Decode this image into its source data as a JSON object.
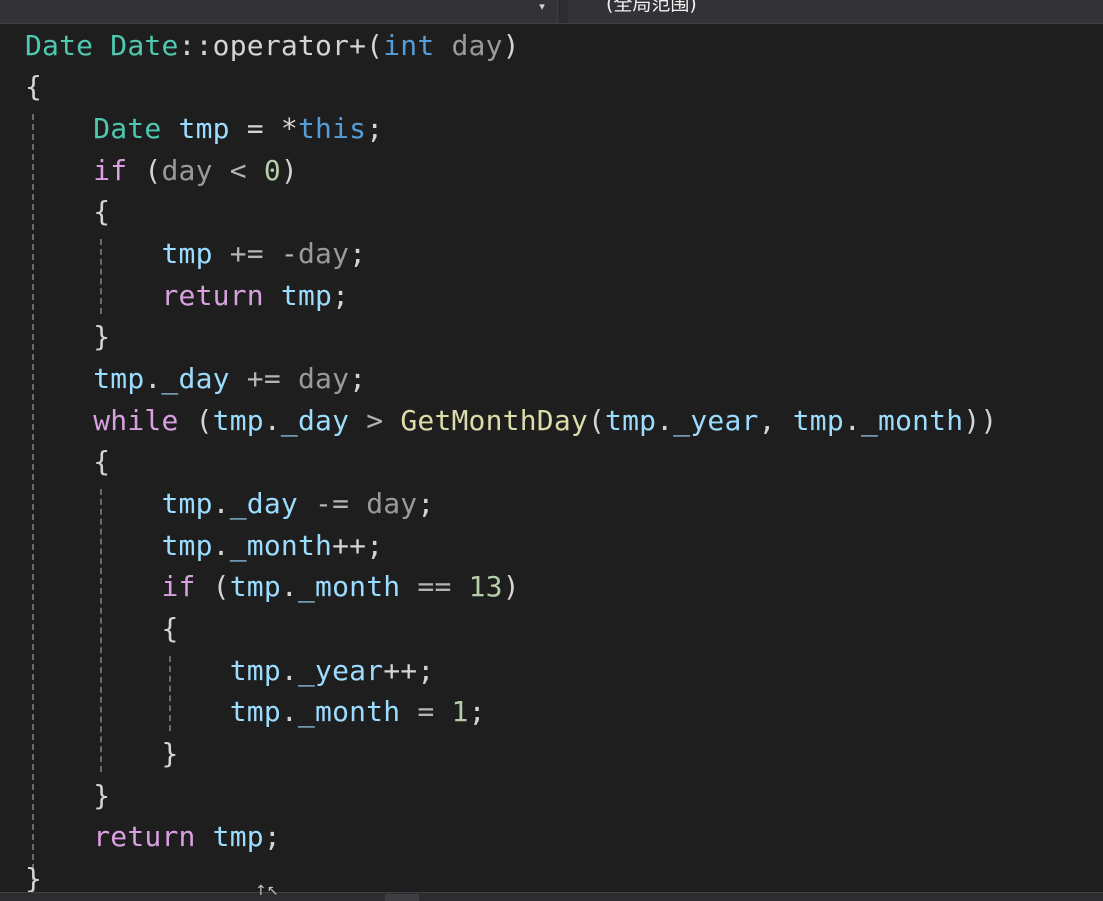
{
  "navigation_bar": {
    "member_dropdown_arrow": "▾",
    "scope_label": "(全局范围)"
  },
  "code": {
    "lines": [
      [
        {
          "t": "Date",
          "c": "type"
        },
        {
          "t": " ",
          "c": "punc"
        },
        {
          "t": "Date",
          "c": "type"
        },
        {
          "t": "::operator+(",
          "c": "punc"
        },
        {
          "t": "int",
          "c": "kw"
        },
        {
          "t": " ",
          "c": "punc"
        },
        {
          "t": "day",
          "c": "param"
        },
        {
          "t": ")",
          "c": "punc"
        }
      ],
      [
        {
          "t": "{",
          "c": "punc"
        }
      ],
      [
        {
          "t": "    ",
          "c": "punc"
        },
        {
          "t": "Date",
          "c": "type"
        },
        {
          "t": " ",
          "c": "punc"
        },
        {
          "t": "tmp",
          "c": "var"
        },
        {
          "t": " = *",
          "c": "punc"
        },
        {
          "t": "this",
          "c": "kw"
        },
        {
          "t": ";",
          "c": "punc"
        }
      ],
      [
        {
          "t": "    ",
          "c": "punc"
        },
        {
          "t": "if",
          "c": "ctrl"
        },
        {
          "t": " (",
          "c": "punc"
        },
        {
          "t": "day",
          "c": "param"
        },
        {
          "t": " < ",
          "c": "op"
        },
        {
          "t": "0",
          "c": "num"
        },
        {
          "t": ")",
          "c": "punc"
        }
      ],
      [
        {
          "t": "    ",
          "c": "punc"
        },
        {
          "t": "{",
          "c": "punc"
        }
      ],
      [
        {
          "t": "        ",
          "c": "punc"
        },
        {
          "t": "tmp",
          "c": "var"
        },
        {
          "t": " += -",
          "c": "op"
        },
        {
          "t": "day",
          "c": "param"
        },
        {
          "t": ";",
          "c": "punc"
        }
      ],
      [
        {
          "t": "        ",
          "c": "punc"
        },
        {
          "t": "return",
          "c": "ctrl"
        },
        {
          "t": " ",
          "c": "punc"
        },
        {
          "t": "tmp",
          "c": "var"
        },
        {
          "t": ";",
          "c": "punc"
        }
      ],
      [
        {
          "t": "    ",
          "c": "punc"
        },
        {
          "t": "}",
          "c": "punc"
        }
      ],
      [
        {
          "t": "    ",
          "c": "punc"
        },
        {
          "t": "tmp",
          "c": "var"
        },
        {
          "t": ".",
          "c": "punc"
        },
        {
          "t": "_day",
          "c": "var"
        },
        {
          "t": " += ",
          "c": "op"
        },
        {
          "t": "day",
          "c": "param"
        },
        {
          "t": ";",
          "c": "punc"
        }
      ],
      [
        {
          "t": "    ",
          "c": "punc"
        },
        {
          "t": "while",
          "c": "ctrl"
        },
        {
          "t": " (",
          "c": "punc"
        },
        {
          "t": "tmp",
          "c": "var"
        },
        {
          "t": ".",
          "c": "punc"
        },
        {
          "t": "_day",
          "c": "var"
        },
        {
          "t": " > ",
          "c": "op"
        },
        {
          "t": "GetMonthDay",
          "c": "fn"
        },
        {
          "t": "(",
          "c": "punc"
        },
        {
          "t": "tmp",
          "c": "var"
        },
        {
          "t": ".",
          "c": "punc"
        },
        {
          "t": "_year",
          "c": "var"
        },
        {
          "t": ", ",
          "c": "punc"
        },
        {
          "t": "tmp",
          "c": "var"
        },
        {
          "t": ".",
          "c": "punc"
        },
        {
          "t": "_month",
          "c": "var"
        },
        {
          "t": "))",
          "c": "punc"
        }
      ],
      [
        {
          "t": "    ",
          "c": "punc"
        },
        {
          "t": "{",
          "c": "punc"
        }
      ],
      [
        {
          "t": "        ",
          "c": "punc"
        },
        {
          "t": "tmp",
          "c": "var"
        },
        {
          "t": ".",
          "c": "punc"
        },
        {
          "t": "_day",
          "c": "var"
        },
        {
          "t": " -= ",
          "c": "op"
        },
        {
          "t": "day",
          "c": "param"
        },
        {
          "t": ";",
          "c": "punc"
        }
      ],
      [
        {
          "t": "        ",
          "c": "punc"
        },
        {
          "t": "tmp",
          "c": "var"
        },
        {
          "t": ".",
          "c": "punc"
        },
        {
          "t": "_month",
          "c": "var"
        },
        {
          "t": "++;",
          "c": "punc"
        }
      ],
      [
        {
          "t": "        ",
          "c": "punc"
        },
        {
          "t": "if",
          "c": "ctrl"
        },
        {
          "t": " (",
          "c": "punc"
        },
        {
          "t": "tmp",
          "c": "var"
        },
        {
          "t": ".",
          "c": "punc"
        },
        {
          "t": "_month",
          "c": "var"
        },
        {
          "t": " == ",
          "c": "op"
        },
        {
          "t": "13",
          "c": "num"
        },
        {
          "t": ")",
          "c": "punc"
        }
      ],
      [
        {
          "t": "        ",
          "c": "punc"
        },
        {
          "t": "{",
          "c": "punc"
        }
      ],
      [
        {
          "t": "            ",
          "c": "punc"
        },
        {
          "t": "tmp",
          "c": "var"
        },
        {
          "t": ".",
          "c": "punc"
        },
        {
          "t": "_year",
          "c": "var"
        },
        {
          "t": "++;",
          "c": "punc"
        }
      ],
      [
        {
          "t": "            ",
          "c": "punc"
        },
        {
          "t": "tmp",
          "c": "var"
        },
        {
          "t": ".",
          "c": "punc"
        },
        {
          "t": "_month",
          "c": "var"
        },
        {
          "t": " = ",
          "c": "op"
        },
        {
          "t": "1",
          "c": "num"
        },
        {
          "t": ";",
          "c": "punc"
        }
      ],
      [
        {
          "t": "        ",
          "c": "punc"
        },
        {
          "t": "}",
          "c": "punc"
        }
      ],
      [
        {
          "t": "    ",
          "c": "punc"
        },
        {
          "t": "}",
          "c": "punc"
        }
      ],
      [
        {
          "t": "    ",
          "c": "punc"
        },
        {
          "t": "return",
          "c": "ctrl"
        },
        {
          "t": " ",
          "c": "punc"
        },
        {
          "t": "tmp",
          "c": "var"
        },
        {
          "t": ";",
          "c": "punc"
        }
      ],
      [
        {
          "t": "}",
          "c": "punc"
        }
      ]
    ]
  },
  "status_bar": {
    "glyph": "↑↖"
  },
  "colors": {
    "type": "#4ec9b0",
    "keyword": "#569cd6",
    "control": "#d8a0df",
    "function": "#dcdcaa",
    "variable": "#9cdcfe",
    "parameter": "#9a9a9a",
    "number": "#b5cea8",
    "background": "#1e1e1e"
  }
}
